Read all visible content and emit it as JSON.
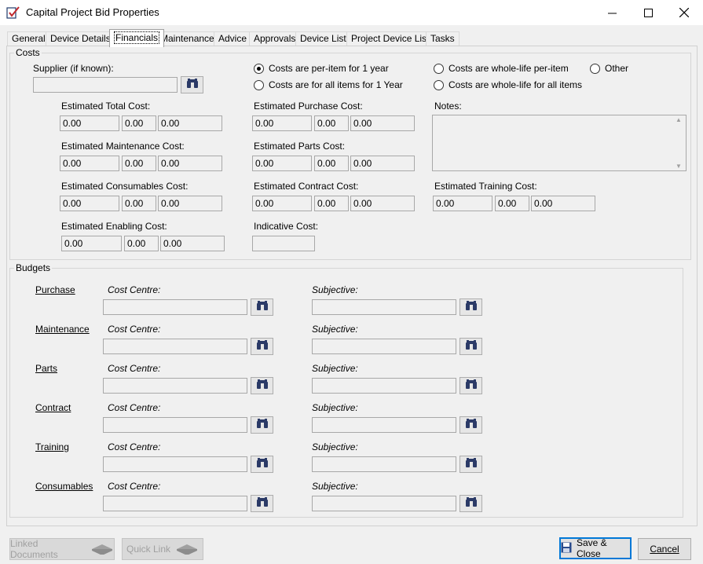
{
  "window": {
    "title": "Capital Project Bid Properties"
  },
  "tabs": [
    {
      "label": "General"
    },
    {
      "label": "Device Details"
    },
    {
      "label": "Financials"
    },
    {
      "label": "Maintenance"
    },
    {
      "label": "Advice"
    },
    {
      "label": "Approvals"
    },
    {
      "label": "Device List"
    },
    {
      "label": "Project Device List"
    },
    {
      "label": "Tasks"
    }
  ],
  "costs": {
    "group_title": "Costs",
    "supplier_label": "Supplier (if known):",
    "supplier_value": "",
    "radios": {
      "per_item_1yr": "Costs are per-item for 1 year",
      "all_items_1yr": "Costs are for all items for 1 Year",
      "whole_life_per_item": "Costs are whole-life per-item",
      "whole_life_all": "Costs are whole-life for all items",
      "other": "Other"
    },
    "total": {
      "label": "Estimated Total Cost:",
      "v1": "0.00",
      "v2": "0.00",
      "v3": "0.00"
    },
    "maintenance": {
      "label": "Estimated Maintenance Cost:",
      "v1": "0.00",
      "v2": "0.00",
      "v3": "0.00"
    },
    "consumables": {
      "label": "Estimated Consumables Cost:",
      "v1": "0.00",
      "v2": "0.00",
      "v3": "0.00"
    },
    "enabling": {
      "label": "Estimated Enabling Cost:",
      "v1": "0.00",
      "v2": "0.00",
      "v3": "0.00"
    },
    "purchase": {
      "label": "Estimated Purchase Cost:",
      "v1": "0.00",
      "v2": "0.00",
      "v3": "0.00"
    },
    "parts": {
      "label": "Estimated Parts Cost:",
      "v1": "0.00",
      "v2": "0.00",
      "v3": "0.00"
    },
    "contract": {
      "label": "Estimated Contract Cost:",
      "v1": "0.00",
      "v2": "0.00",
      "v3": "0.00"
    },
    "indicative": {
      "label": "Indicative Cost:",
      "value": ""
    },
    "notes_label": "Notes:",
    "training": {
      "label": "Estimated Training Cost:",
      "v1": "0.00",
      "v2": "0.00",
      "v3": "0.00"
    }
  },
  "budgets": {
    "group_title": "Budgets",
    "cost_centre_label": "Cost Centre:",
    "subjective_label": "Subjective:",
    "rows": [
      {
        "name": "Purchase"
      },
      {
        "name": "Maintenance"
      },
      {
        "name": "Parts"
      },
      {
        "name": "Contract"
      },
      {
        "name": "Training"
      },
      {
        "name": "Consumables"
      }
    ]
  },
  "footer": {
    "linked_documents": "Linked Documents",
    "quick_link": "Quick Link",
    "save_close": "Save & Close",
    "cancel": "Cancel"
  }
}
